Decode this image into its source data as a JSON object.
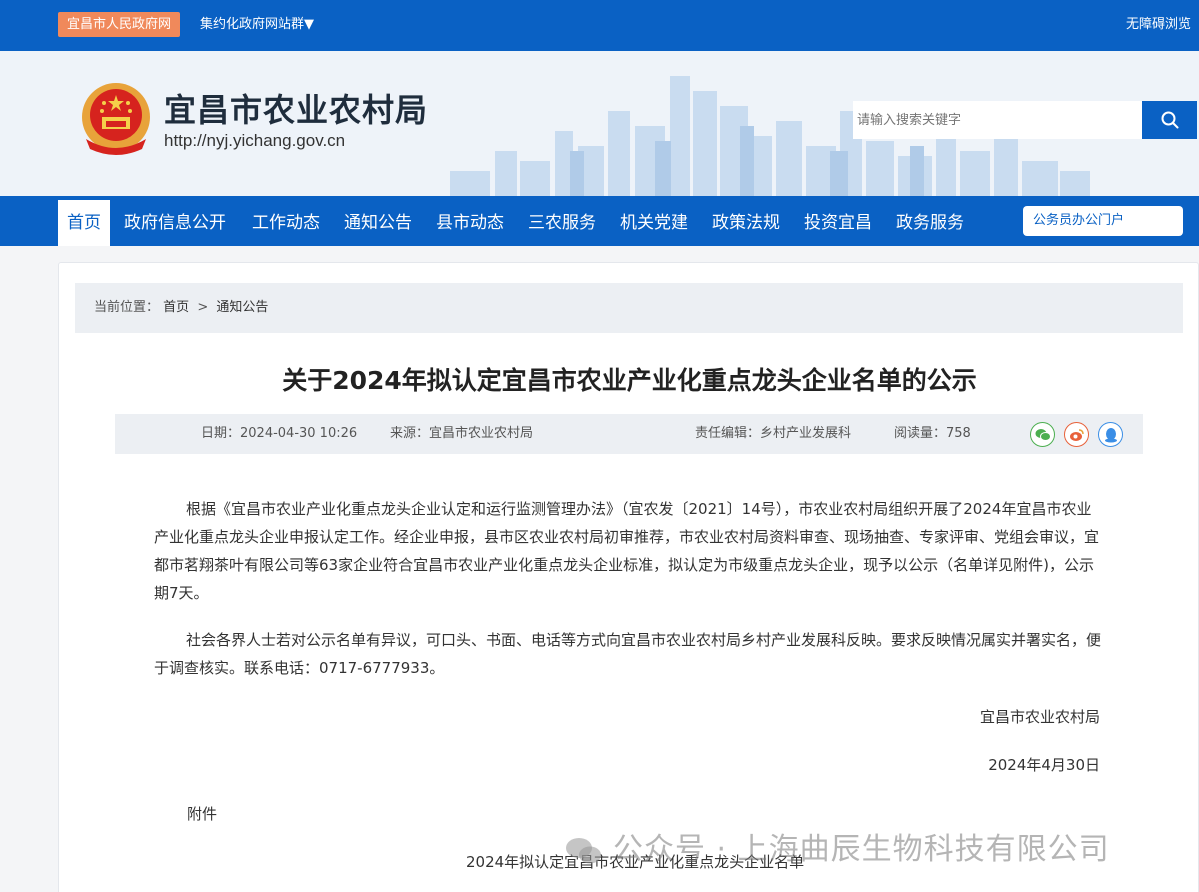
{
  "topbar": {
    "gov_link": "宜昌市人民政府网",
    "site_group": "集约化政府网站群▼",
    "accessible": "无障碍浏览"
  },
  "header": {
    "site_title": "宜昌市农业农村局",
    "site_url": "http://nyj.yichang.gov.cn",
    "search_placeholder": "请输入搜索关键字"
  },
  "nav": {
    "items": [
      {
        "label": "首页"
      },
      {
        "label": "政府信息公开"
      },
      {
        "label": "工作动态"
      },
      {
        "label": "通知公告"
      },
      {
        "label": "县市动态"
      },
      {
        "label": "三农服务"
      },
      {
        "label": "机关党建"
      },
      {
        "label": "政策法规"
      },
      {
        "label": "投资宜昌"
      },
      {
        "label": "政务服务"
      }
    ],
    "portal": "公务员办公门户"
  },
  "breadcrumb": {
    "prefix": "当前位置：",
    "home": "首页",
    "sep": ">",
    "current": "通知公告"
  },
  "article": {
    "title": "关于2024年拟认定宜昌市农业产业化重点龙头企业名单的公示",
    "date": "日期：2024-04-30 10:26",
    "source": "来源：宜昌市农业农村局",
    "editor": "责任编辑：乡村产业发展科",
    "views": "阅读量：758",
    "para1": "根据《宜昌市农业产业化重点龙头企业认定和运行监测管理办法》（宜农发〔2021〕14号），市农业农村局组织开展了2024年宜昌市农业产业化重点龙头企业申报认定工作。经企业申报，县市区农业农村局初审推荐，市农业农村局资料审查、现场抽查、专家评审、党组会审议，宜都市茗翔茶叶有限公司等63家企业符合宜昌市农业产业化重点龙头企业标准，拟认定为市级重点龙头企业，现予以公示（名单详见附件)，公示期7天。",
    "para2": "社会各界人士若对公示名单有异议，可口头、书面、电话等方式向宜昌市农业农村局乡村产业发展科反映。要求反映情况属实并署实名，便于调查核实。联系电话：0717-6777933。",
    "signature": "宜昌市农业农村局",
    "sign_date": "2024年4月30日",
    "attachment_label": "附件",
    "attachment_file": "2024年拟认定宜昌市农业产业化重点龙头企业名单"
  },
  "watermark": "公众号 · 上海曲辰生物科技有限公司",
  "colors": {
    "primary": "#0a61c4",
    "accent_orange": "#f0895b",
    "wechat": "#4caf50",
    "weibo": "#e8613a",
    "qq": "#3a8ee6"
  }
}
